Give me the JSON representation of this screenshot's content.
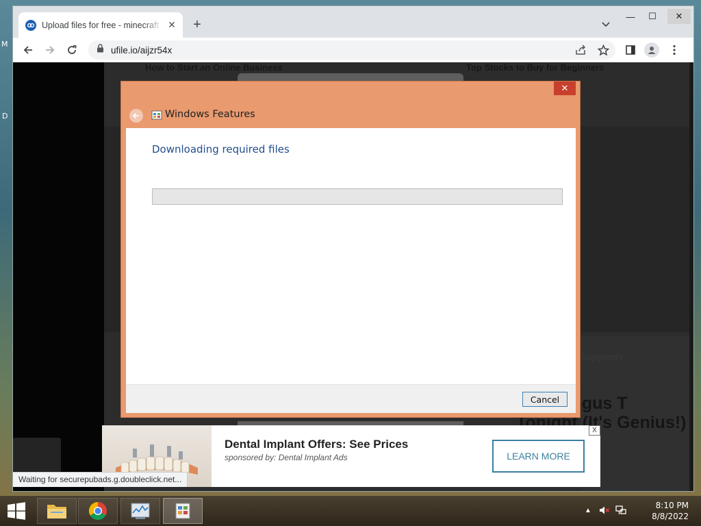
{
  "desktop": {
    "edge_label_top": "M",
    "edge_label_mid": "D"
  },
  "browser": {
    "tab": {
      "title": "Upload files for free - minecraft",
      "close_glyph": "✕"
    },
    "newtab_glyph": "+",
    "window_controls": {
      "minimize": "—",
      "maximize": "☐",
      "close": "✕"
    },
    "url": "ufile.io/aijzr54x",
    "status_text": "Waiting for securepubads.g.doubleclick.net..."
  },
  "page": {
    "ghost_left_headline": "How to Start an Online Business",
    "ghost_right_headline": "Top Stocks to Buy for Beginners",
    "ghost_brand": "buygoods",
    "ghost_headline_line1": "nail Fungus T",
    "ghost_headline_line2": "Tonight (It's Genius!)"
  },
  "ad": {
    "title": "Dental Implant Offers: See Prices",
    "sponsor": "sponsored by: Dental Implant Ads",
    "button_label": "LEARN MORE",
    "close_glyph": "X"
  },
  "dialog": {
    "title": "Windows Features",
    "heading": "Downloading required files",
    "progress_fraction": 0,
    "cancel_label": "Cancel",
    "close_glyph": "✕"
  },
  "taskbar": {
    "time": "8:10 PM",
    "date": "8/8/2022",
    "tray_arrow": "▲"
  },
  "colors": {
    "dialog_frame": "#e99a6e",
    "dialog_close": "#c7402e",
    "dialog_heading": "#1f4e8c",
    "ad_accent": "#3b7fa0"
  }
}
